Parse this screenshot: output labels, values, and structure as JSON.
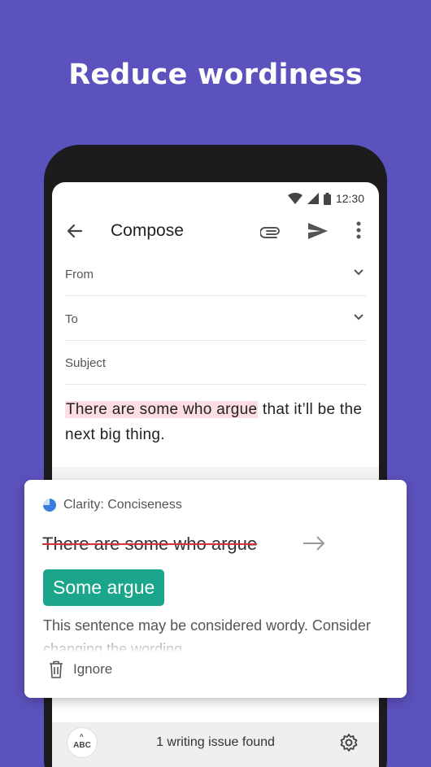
{
  "headline": "Reduce wordiness",
  "statusbar": {
    "time": "12:30"
  },
  "appbar": {
    "title": "Compose",
    "icons": [
      "back-arrow-icon",
      "paperclip-icon",
      "send-icon",
      "more-vert-icon"
    ]
  },
  "fields": {
    "from_label": "From",
    "to_label": "To",
    "subject_label": "Subject"
  },
  "message": {
    "highlighted": "There are some who argue",
    "rest": " that it’ll be the next big thing."
  },
  "suggestion": {
    "category": "Clarity: Conciseness",
    "original": "There are some who argue",
    "replacement": "Some argue",
    "explanation": "This sentence may be considered wordy. Consider changing the wording.",
    "ignore_label": "Ignore"
  },
  "bottombar": {
    "badge": "ABC",
    "status": "1 writing issue found"
  },
  "colors": {
    "background": "#5c52bd",
    "highlight": "#fcdde3",
    "accept": "#1ba68c",
    "strike": "#d6323c"
  }
}
